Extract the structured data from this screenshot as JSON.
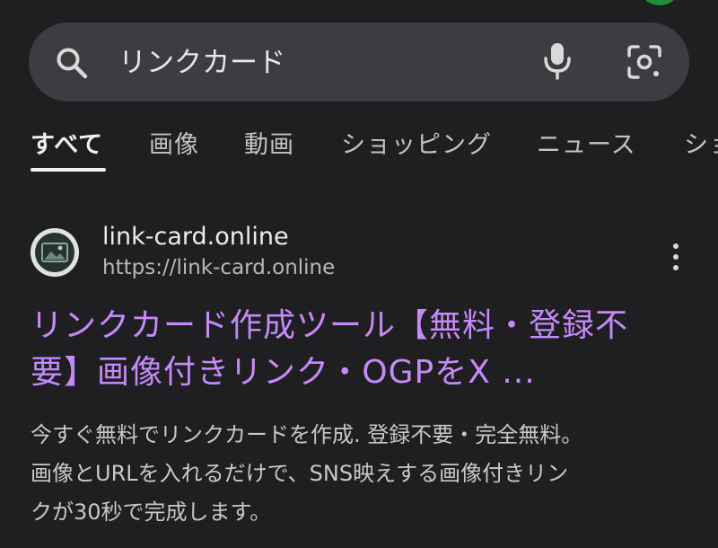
{
  "search": {
    "query": "リンクカード"
  },
  "tabs": [
    {
      "label": "すべて",
      "active": true
    },
    {
      "label": "画像",
      "active": false
    },
    {
      "label": "動画",
      "active": false
    },
    {
      "label": "ショッピング",
      "active": false
    },
    {
      "label": "ニュース",
      "active": false
    },
    {
      "label": "ショ",
      "active": false
    }
  ],
  "result": {
    "site_name": "link-card.online",
    "site_url": "https://link-card.online",
    "title_line1": "リンクカード作成ツール【無料・登録不",
    "title_line2": "要】画像付きリンク・OGPをX ...",
    "snippet_line1": "今すぐ無料でリンクカードを作成. 登録不要・完全無料。",
    "snippet_line2": "画像とURLを入れるだけで、SNS映えする画像付きリン",
    "snippet_line3": "クが30秒で完成します。"
  },
  "colors": {
    "background": "#1f1f22",
    "search_bar": "#3c3d40",
    "link_title": "#c58af9",
    "status_dot": "#1f8f3a"
  },
  "icons": {
    "search": "search-icon",
    "mic": "mic-icon",
    "lens": "lens-icon",
    "more": "more-vert-icon",
    "favicon": "site-favicon"
  }
}
